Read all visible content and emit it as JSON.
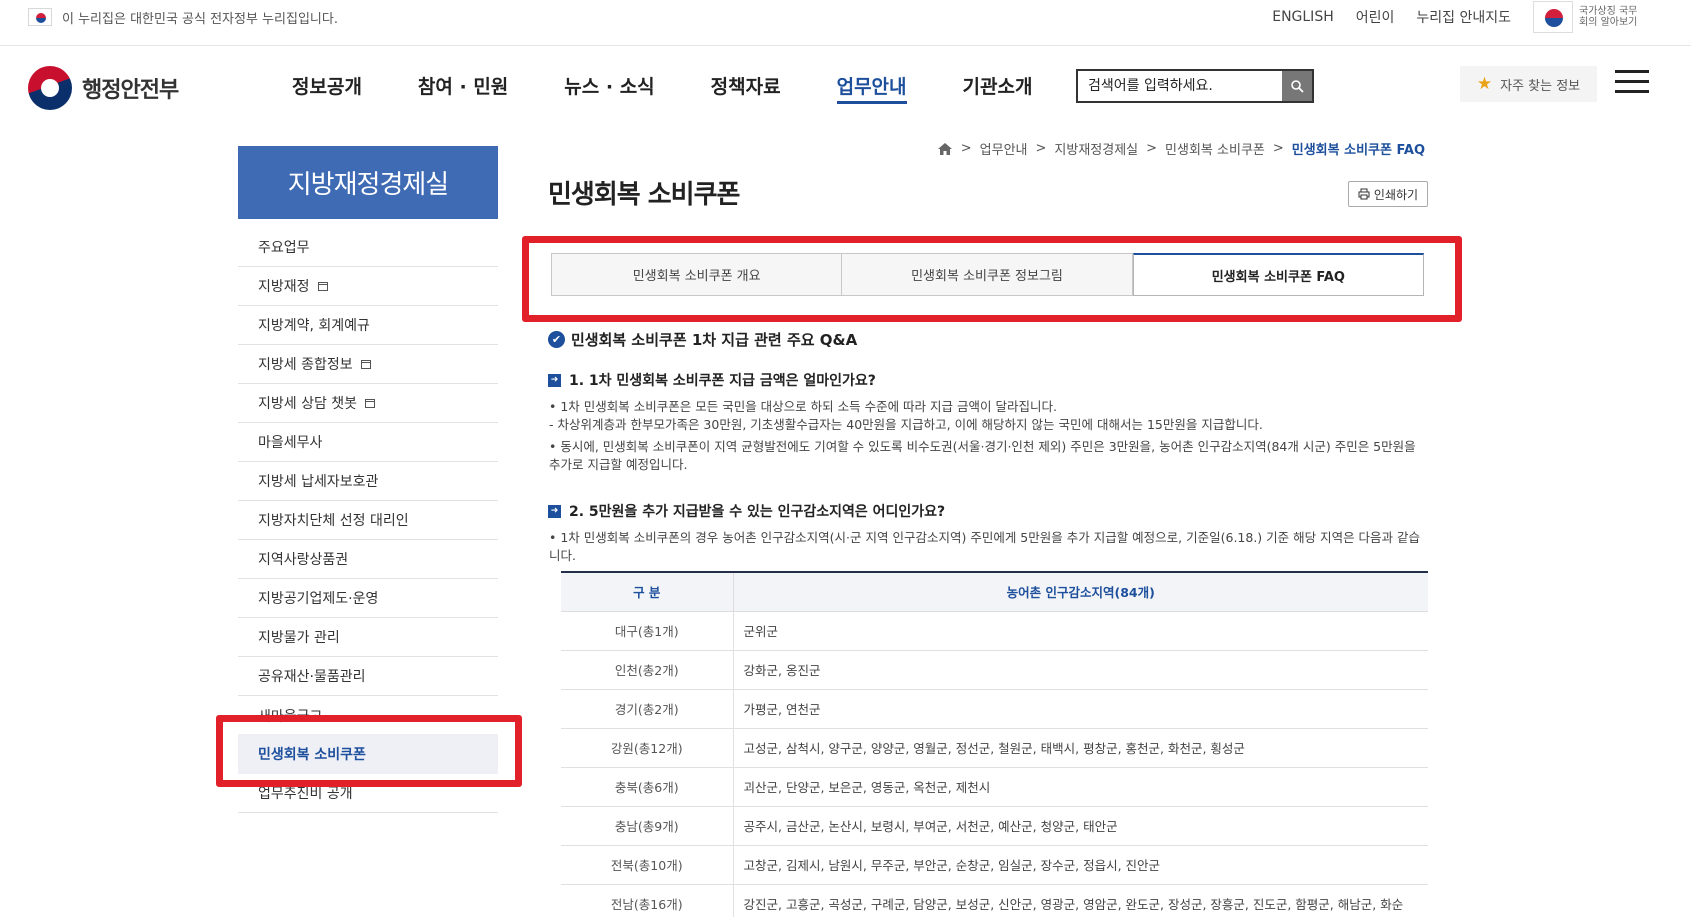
{
  "govbar": {
    "notice": "이 누리집은 대한민국 공식 전자정부 누리집입니다.",
    "links": [
      "ENGLISH",
      "어린이",
      "누리집 안내지도"
    ],
    "mark_text": "국가상징 국무회의 알아보기"
  },
  "header": {
    "logo": "행정안전부",
    "gnb": [
      "정보공개",
      "참여 · 민원",
      "뉴스 · 소식",
      "정책자료",
      "업무안내",
      "기관소개"
    ],
    "active_gnb": "업무안내",
    "search_placeholder": "검색어를 입력하세요.",
    "faq_label": "자주 찾는 정보"
  },
  "sidebar": {
    "title": "지방재정경제실",
    "items": [
      "주요업무",
      "지방재정",
      "지방계약, 회계예규",
      "지방세 종합정보",
      "지방세 상담 챗봇",
      "마을세무사",
      "지방세 납세자보호관",
      "지방자치단체 선정 대리인",
      "지역사랑상품권",
      "지방공기업제도·운영",
      "지방물가 관리",
      "공유재산·물품관리",
      "새마을금고",
      "민생회복 소비쿠폰",
      "업무추진비 공개"
    ]
  },
  "content": {
    "breadcrumb": [
      "업무안내",
      "지방재정경제실",
      "민생회복 소비쿠폰",
      "민생회복 소비쿠폰 FAQ"
    ],
    "title": "민생회복 소비쿠폰",
    "print_label": "인쇄하기",
    "tabs": [
      "민생회복 소비쿠폰 개요",
      "민생회복 소비쿠폰 정보그림",
      "민생회복 소비쿠폰 FAQ"
    ],
    "qa_title": "민생회복 소비쿠폰 1차 지급 관련 주요 Q&A",
    "q1": "1. 1차 민생회복 소비쿠폰 지급 금액은 얼마인가요?",
    "a1_1": "• 1차 민생회복 소비쿠폰은 모든 국민을 대상으로 하되 소득 수준에 따라 지급 금액이 달라집니다.",
    "a1_2": " - 차상위계층과 한부모가족은 30만원, 기초생활수급자는 40만원을 지급하고, 이에 해당하지 않는 국민에 대해서는 15만원을 지급합니다.",
    "a1_3": "• 동시에, 민생회복 소비쿠폰이 지역 균형발전에도 기여할 수 있도록 비수도권(서울·경기·인천 제외) 주민은 3만원을, 농어촌 인구감소지역(84개 시군) 주민은 5만원을 추가로 지급할 예정입니다.",
    "q2": "2. 5만원을 추가 지급받을 수 있는 인구감소지역은 어디인가요?",
    "a2_1": "• 1차 민생회복 소비쿠폰의 경우 농어촌 인구감소지역(시·군 지역 인구감소지역) 주민에게 5만원을 추가 지급할 예정으로, 기준일(6.18.) 기준 해당 지역은 다음과 같습니다.",
    "table": {
      "headers": [
        "구 분",
        "농어촌 인구감소지역(84개)"
      ],
      "rows": [
        [
          "대구(총1개)",
          "군위군"
        ],
        [
          "인천(총2개)",
          "강화군, 옹진군"
        ],
        [
          "경기(총2개)",
          "가평군, 연천군"
        ],
        [
          "강원(총12개)",
          "고성군, 삼척시, 양구군, 양양군, 영월군, 정선군, 철원군, 태백시, 평창군, 홍천군, 화천군, 횡성군"
        ],
        [
          "충북(총6개)",
          "괴산군, 단양군, 보은군, 영동군, 옥천군, 제천시"
        ],
        [
          "충남(총9개)",
          "공주시, 금산군, 논산시, 보령시, 부여군, 서천군, 예산군, 청양군, 태안군"
        ],
        [
          "전북(총10개)",
          "고창군, 김제시, 남원시, 무주군, 부안군, 순창군, 임실군, 장수군, 정읍시, 진안군"
        ],
        [
          "전남(총16개)",
          "강진군, 고흥군, 곡성군, 구례군, 담양군, 보성군, 신안군, 영광군, 영암군, 완도군, 장성군, 장흥군, 진도군, 함평군, 해남군, 화순"
        ]
      ]
    }
  },
  "colors": {
    "primary": "#1d4f9c",
    "side_title": "#3f6ab4",
    "highlight": "#e2202a"
  }
}
